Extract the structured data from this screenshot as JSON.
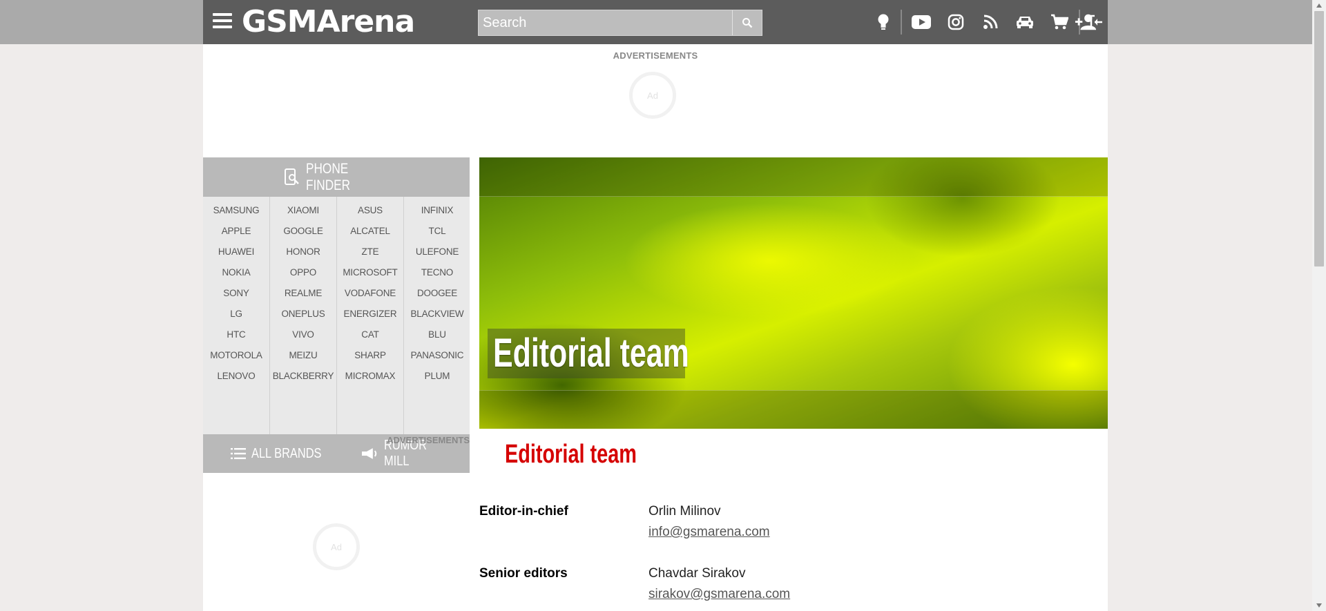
{
  "header": {
    "logo_text": "GSMArena",
    "search_placeholder": "Search"
  },
  "ads": {
    "top_label": "ADVERTISEMENTS",
    "side_label": "ADVERTISEMENTS",
    "spinner_text": "Ad"
  },
  "sidebar": {
    "finder_label": "PHONE FINDER",
    "brand_columns": [
      [
        "SAMSUNG",
        "APPLE",
        "HUAWEI",
        "NOKIA",
        "SONY",
        "LG",
        "HTC",
        "MOTOROLA",
        "LENOVO"
      ],
      [
        "XIAOMI",
        "GOOGLE",
        "HONOR",
        "OPPO",
        "REALME",
        "ONEPLUS",
        "VIVO",
        "MEIZU",
        "BLACKBERRY"
      ],
      [
        "ASUS",
        "ALCATEL",
        "ZTE",
        "MICROSOFT",
        "VODAFONE",
        "ENERGIZER",
        "CAT",
        "SHARP",
        "MICROMAX"
      ],
      [
        "INFINIX",
        "TCL",
        "ULEFONE",
        "TECNO",
        "DOOGEE",
        "BLACKVIEW",
        "BLU",
        "PANASONIC",
        "PLUM"
      ]
    ],
    "all_brands_label": "ALL BRANDS",
    "rumor_mill_label": "RUMOR MILL"
  },
  "hero": {
    "title": "Editorial team"
  },
  "content": {
    "page_title": "Editorial team",
    "sections": [
      {
        "role": "Editor-in-chief",
        "name": "Orlin Milinov",
        "email": "info@gsmarena.com"
      },
      {
        "role": "Senior editors",
        "name": "Chavdar Sirakov",
        "email": "sirakov@gsmarena.com"
      }
    ]
  },
  "colors": {
    "header_bg": "#5c5c5c",
    "accent_red": "#d50000",
    "sidebar_gray": "#b9b9b9"
  }
}
